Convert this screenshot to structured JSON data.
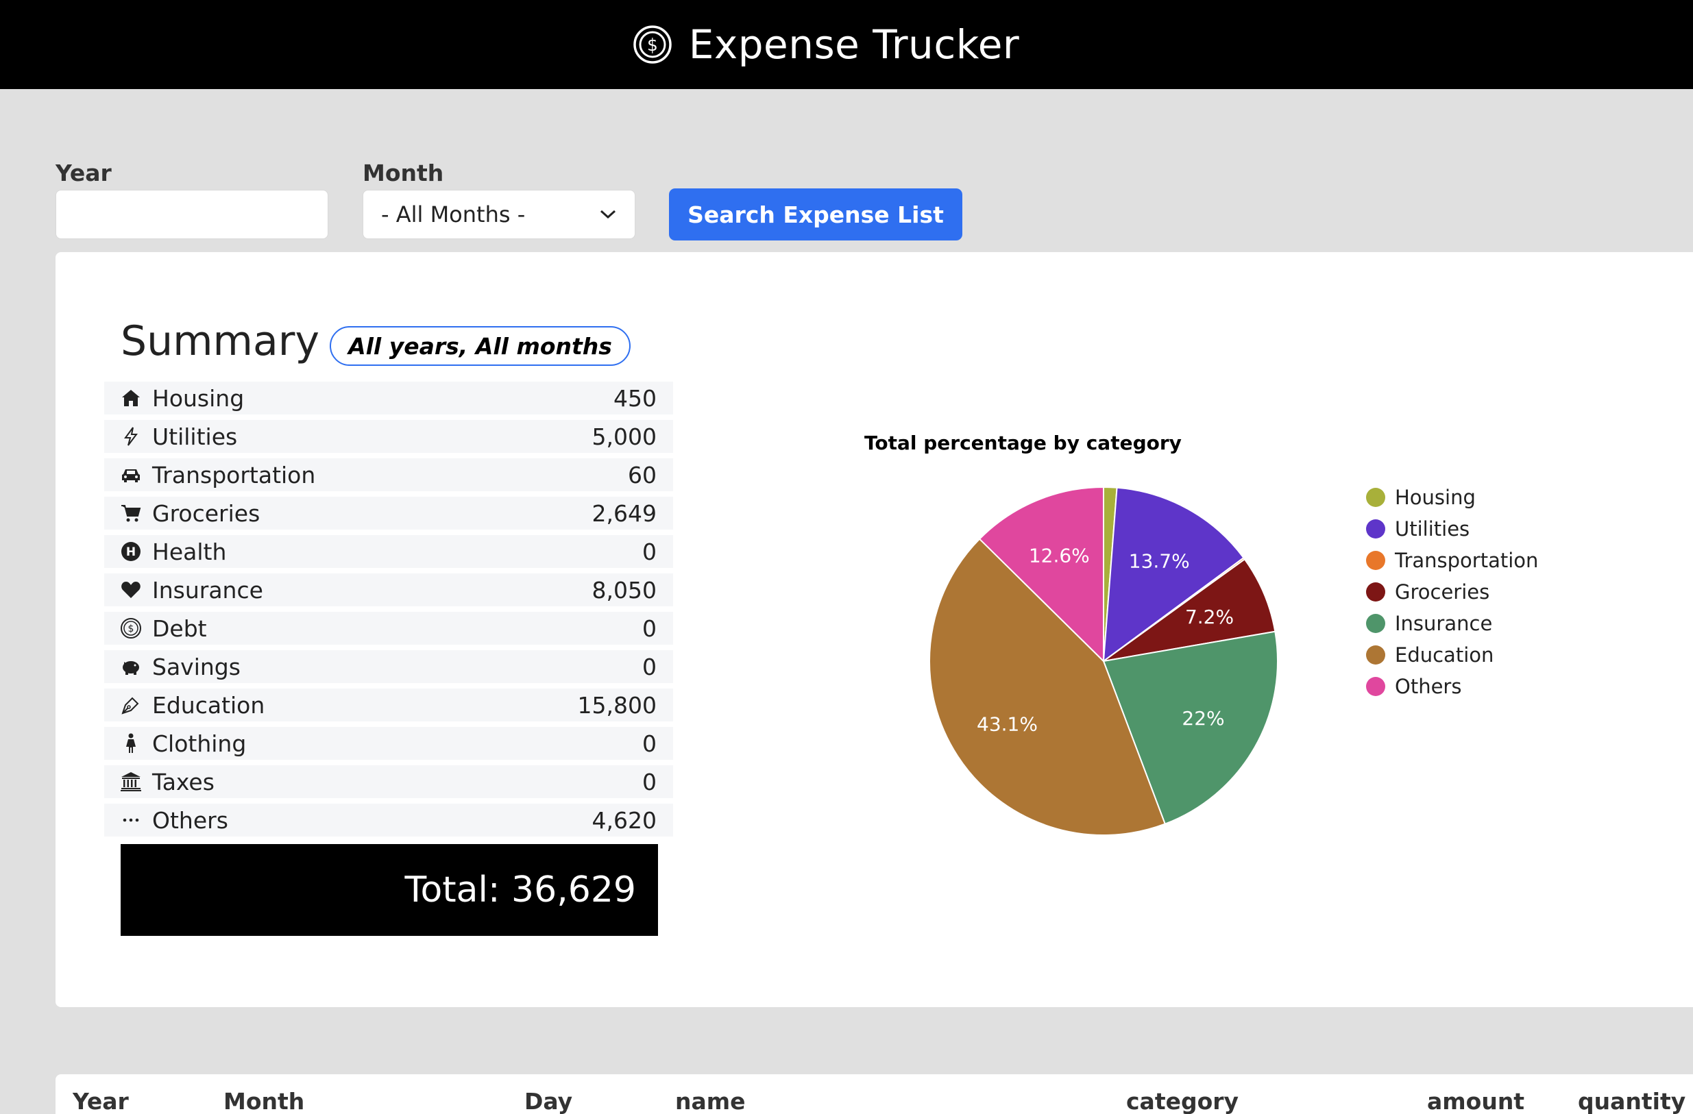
{
  "app": {
    "title": "Expense Trucker",
    "logo_icon": "dollar-circle-icon"
  },
  "filters": {
    "year_label": "Year",
    "year_value": "",
    "month_label": "Month",
    "month_selected": "- All Months -",
    "search_button": "Search Expense List"
  },
  "summary": {
    "title": "Summary",
    "scope": "All years, All months",
    "items": [
      {
        "label": "Housing",
        "value": "450",
        "icon": "house-icon"
      },
      {
        "label": "Utilities",
        "value": "5,000",
        "icon": "lightning-icon"
      },
      {
        "label": "Transportation",
        "value": "60",
        "icon": "car-icon"
      },
      {
        "label": "Groceries",
        "value": "2,649",
        "icon": "cart-icon"
      },
      {
        "label": "Health",
        "value": "0",
        "icon": "health-icon"
      },
      {
        "label": "Insurance",
        "value": "8,050",
        "icon": "heart-icon"
      },
      {
        "label": "Debt",
        "value": "0",
        "icon": "dollar-circle-icon"
      },
      {
        "label": "Savings",
        "value": "0",
        "icon": "piggy-bank-icon"
      },
      {
        "label": "Education",
        "value": "15,800",
        "icon": "pen-icon"
      },
      {
        "label": "Clothing",
        "value": "0",
        "icon": "person-dress-icon"
      },
      {
        "label": "Taxes",
        "value": "0",
        "icon": "bank-icon"
      },
      {
        "label": "Others",
        "value": "4,620",
        "icon": "ellipsis-icon"
      }
    ],
    "total": "Total: 36,629"
  },
  "chart_data": {
    "type": "pie",
    "title": "Total percentage by category",
    "legend_position": "right",
    "slices": [
      {
        "name": "Housing",
        "value": 450,
        "color": "#a8b03a",
        "label": ""
      },
      {
        "name": "Utilities",
        "value": 5000,
        "color": "#5e35c9",
        "label": "13.7%"
      },
      {
        "name": "Transportation",
        "value": 60,
        "color": "#e8772a",
        "label": ""
      },
      {
        "name": "Groceries",
        "value": 2649,
        "color": "#7d1615",
        "label": "7.2%"
      },
      {
        "name": "Insurance",
        "value": 8050,
        "color": "#4f956a",
        "label": "22%"
      },
      {
        "name": "Education",
        "value": 15800,
        "color": "#ad7634",
        "label": "43.1%"
      },
      {
        "name": "Others",
        "value": 4620,
        "color": "#e0479e",
        "label": "12.6%"
      }
    ]
  },
  "table": {
    "columns": [
      "Year",
      "Month",
      "Day",
      "name",
      "category",
      "amount",
      "quantity"
    ]
  }
}
